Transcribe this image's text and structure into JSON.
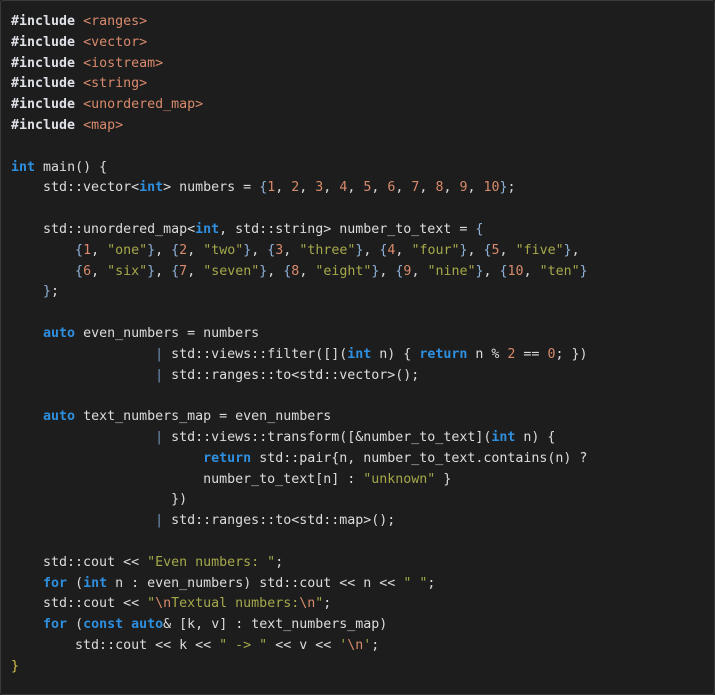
{
  "editor": {
    "language": "cpp",
    "background_color": "#1d1d1d",
    "border_color": "#3a3a3a",
    "foreground_color": "#dcdcdc",
    "theme": "dark"
  },
  "palette": {
    "preprocessor": "#dfe1e8",
    "header": "#d98a6c",
    "keyword": "#2f8fdf",
    "number": "#d98a6c",
    "string": "#a5a84a",
    "escape": "#d98a6c",
    "identifier": "#dcdcdc",
    "brace_blue": "#8fb2d9",
    "brace_gold": "#d9c44a",
    "pipe": "#6f93b8"
  },
  "code": {
    "lines": [
      {
        "id": "l1",
        "text": "#include <ranges>"
      },
      {
        "id": "l2",
        "text": "#include <vector>"
      },
      {
        "id": "l3",
        "text": "#include <iostream>"
      },
      {
        "id": "l4",
        "text": "#include <string>"
      },
      {
        "id": "l5",
        "text": "#include <unordered_map>"
      },
      {
        "id": "l6",
        "text": "#include <map>"
      },
      {
        "id": "l7",
        "text": ""
      },
      {
        "id": "l8",
        "text": "int main() {"
      },
      {
        "id": "l9",
        "text": "    std::vector<int> numbers = {1, 2, 3, 4, 5, 6, 7, 8, 9, 10};"
      },
      {
        "id": "l10",
        "text": ""
      },
      {
        "id": "l11",
        "text": "    std::unordered_map<int, std::string> number_to_text = {"
      },
      {
        "id": "l12",
        "text": "        {1, \"one\"}, {2, \"two\"}, {3, \"three\"}, {4, \"four\"}, {5, \"five\"},"
      },
      {
        "id": "l13",
        "text": "        {6, \"six\"}, {7, \"seven\"}, {8, \"eight\"}, {9, \"nine\"}, {10, \"ten\"}"
      },
      {
        "id": "l14",
        "text": "    };"
      },
      {
        "id": "l15",
        "text": ""
      },
      {
        "id": "l16",
        "text": "    auto even_numbers = numbers"
      },
      {
        "id": "l17",
        "text": "                  | std::views::filter([](int n) { return n % 2 == 0; })"
      },
      {
        "id": "l18",
        "text": "                  | std::ranges::to<std::vector>();"
      },
      {
        "id": "l19",
        "text": ""
      },
      {
        "id": "l20",
        "text": "    auto text_numbers_map = even_numbers"
      },
      {
        "id": "l21",
        "text": "                  | std::views::transform([&number_to_text](int n) {"
      },
      {
        "id": "l22",
        "text": "                        return std::pair{n, number_to_text.contains(n) ?"
      },
      {
        "id": "l23",
        "text": "                        number_to_text[n] : \"unknown\" }"
      },
      {
        "id": "l24",
        "text": "                    })"
      },
      {
        "id": "l25",
        "text": "                  | std::ranges::to<std::map>();"
      },
      {
        "id": "l26",
        "text": ""
      },
      {
        "id": "l27",
        "text": "    std::cout << \"Even numbers: \";"
      },
      {
        "id": "l28",
        "text": "    for (int n : even_numbers) std::cout << n << \" \";"
      },
      {
        "id": "l29",
        "text": "    std::cout << \"\\nTextual numbers:\\n\";"
      },
      {
        "id": "l30",
        "text": "    for (const auto& [k, v] : text_numbers_map)"
      },
      {
        "id": "l31",
        "text": "        std::cout << k << \" -> \" << v << '\\n';"
      },
      {
        "id": "l32",
        "text": "}"
      }
    ],
    "includes": [
      "<ranges>",
      "<vector>",
      "<iostream>",
      "<string>",
      "<unordered_map>",
      "<map>"
    ],
    "keywords_used": [
      "int",
      "auto",
      "return",
      "for",
      "const"
    ],
    "vector_literal": [
      1,
      2,
      3,
      4,
      5,
      6,
      7,
      8,
      9,
      10
    ],
    "number_to_text_map": [
      {
        "key": 1,
        "value": "one"
      },
      {
        "key": 2,
        "value": "two"
      },
      {
        "key": 3,
        "value": "three"
      },
      {
        "key": 4,
        "value": "four"
      },
      {
        "key": 5,
        "value": "five"
      },
      {
        "key": 6,
        "value": "six"
      },
      {
        "key": 7,
        "value": "seven"
      },
      {
        "key": 8,
        "value": "eight"
      },
      {
        "key": 9,
        "value": "nine"
      },
      {
        "key": 10,
        "value": "ten"
      }
    ],
    "fallback_text": "unknown",
    "output_strings": [
      "Even numbers: ",
      "\\nTextual numbers:\\n",
      " ",
      " -> ",
      "\\n"
    ]
  }
}
